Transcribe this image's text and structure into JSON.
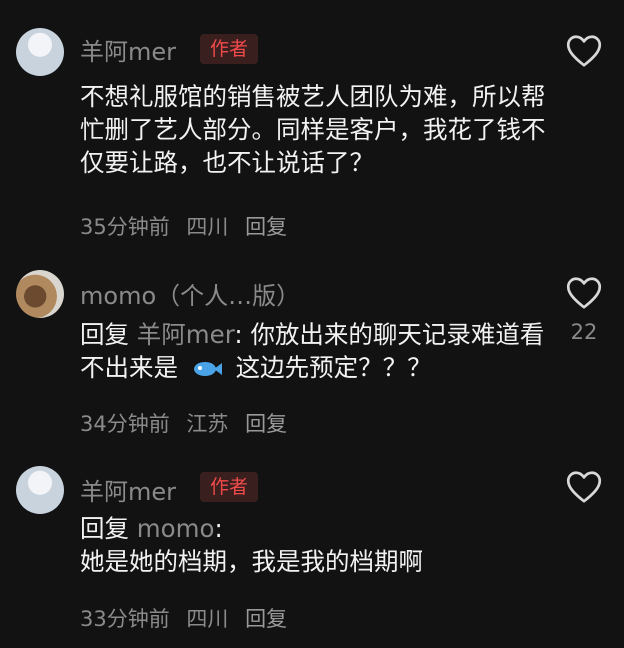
{
  "comments": [
    {
      "username": "羊阿mer",
      "author_badge": "作者",
      "text": "不想礼服馆的销售被艺人团队为难，所以帮忙删了艺人部分。同样是客户，我花了钱不仅要让路，也不让说话了？",
      "time": "35分钟前",
      "location": "四川",
      "reply": "回复"
    },
    {
      "username": "momo",
      "username_suffix": "（个人…版）",
      "reply_prefix": "回复",
      "reply_target": "羊阿mer",
      "text_before_icon": "你放出来的聊天记录难道看不出来是",
      "text_after_icon": "这边先预定？？？",
      "time": "34分钟前",
      "location": "江苏",
      "reply": "回复",
      "like_count": "22"
    },
    {
      "username": "羊阿mer",
      "author_badge": "作者",
      "reply_prefix": "回复",
      "reply_target": "momo",
      "text": "她是她的档期，我是我的档期啊",
      "time": "33分钟前",
      "location": "四川",
      "reply": "回复"
    }
  ],
  "icons": {
    "like": "heart-outline-icon",
    "inline_emoji": "fish-icon"
  },
  "colors": {
    "background": "#121212",
    "author_badge": "#f04a4a",
    "meta": "#8a8a8a"
  }
}
